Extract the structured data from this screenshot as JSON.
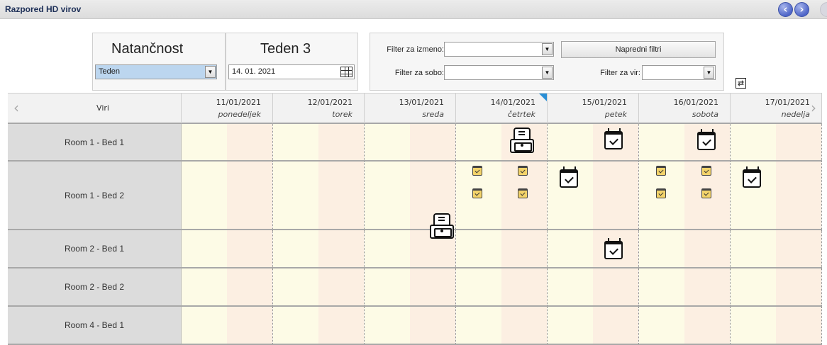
{
  "window": {
    "title": "Razpored HD virov"
  },
  "controls": {
    "precision_label": "Natančnost",
    "precision_value": "Teden",
    "week_label": "Teden 3",
    "date_value": "14. 01. 2021",
    "shift_filter_label": "Filter za izmeno:",
    "shift_filter_value": "",
    "room_filter_label": "Filter za sobo:",
    "room_filter_value": "",
    "resource_filter_label": "Filter za vir:",
    "resource_filter_value": "",
    "advanced_filters_label": "Napredni filtri"
  },
  "grid": {
    "resources_header": "Viri",
    "days": [
      {
        "date": "11/01/2021",
        "name": "ponedeljek"
      },
      {
        "date": "12/01/2021",
        "name": "torek"
      },
      {
        "date": "13/01/2021",
        "name": "sreda"
      },
      {
        "date": "14/01/2021",
        "name": "četrtek"
      },
      {
        "date": "15/01/2021",
        "name": "petek"
      },
      {
        "date": "16/01/2021",
        "name": "sobota"
      },
      {
        "date": "17/01/2021",
        "name": "nedelja"
      }
    ],
    "rows": [
      {
        "label": "Room 1 - Bed 1"
      },
      {
        "label": "Room 1 - Bed 2"
      },
      {
        "label": "Room 2 - Bed 1"
      },
      {
        "label": "Room 2 - Bed 2"
      },
      {
        "label": "Room 4 - Bed 1"
      }
    ]
  },
  "icons": {
    "prev": "chevron-left-icon",
    "next": "chevron-right-icon",
    "appointment": "calendar-check-icon",
    "dialysis_machine": "dialysis-machine-icon",
    "refresh": "refresh-icon"
  },
  "colors": {
    "nav_button": "#4f66c8",
    "cell_light": "#fdfbe6",
    "cell_peach": "#fcefe2",
    "row_label_bg": "#dcdcdc",
    "appointment_small": "#f3d36a",
    "current_day_marker": "#2a8fd6"
  }
}
